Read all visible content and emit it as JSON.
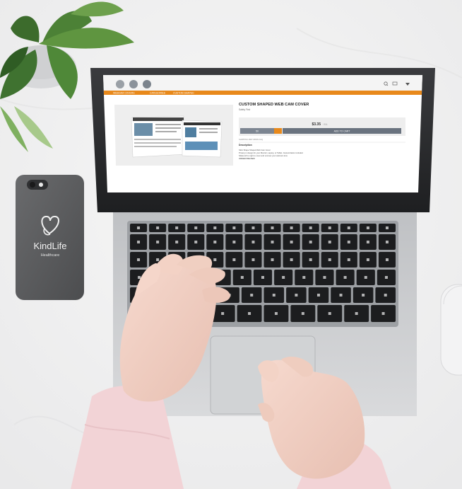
{
  "phone": {
    "brand": "KindLife",
    "sub": "Healthcare"
  },
  "site": {
    "nav": [
      "WEBCAM COVERS",
      "CATEGORIES",
      "CUSTOM SHAPED"
    ],
    "product_title": "CUSTOM SHAPED WEB CAM COVER",
    "product_sub": "Safety First",
    "price": "$3.35",
    "price_unit": "/ EA",
    "qty": "50",
    "add_to_cart": "ADD TO CART",
    "meta": "SHIPPING   RETURNS   FAQ",
    "description_heading": "Description",
    "description_lines": [
      "Stick Shape Shaped Web Cam Cover",
      "Privacy in design for your Monitor, Laptop, or Tablet. Customization included.",
      "Slides left to right to cover and uncover your webcam lens",
      "ORDER PREVIEW"
    ],
    "icons": [
      "search-icon",
      "cart-icon",
      "menu-icon"
    ]
  },
  "colors": {
    "accent": "#e8891b",
    "background": "#f4f4f4",
    "laptop_body": "#c9cbcd",
    "phone_body": "#5d5d5f",
    "sleeve": "#f2d3d6"
  }
}
